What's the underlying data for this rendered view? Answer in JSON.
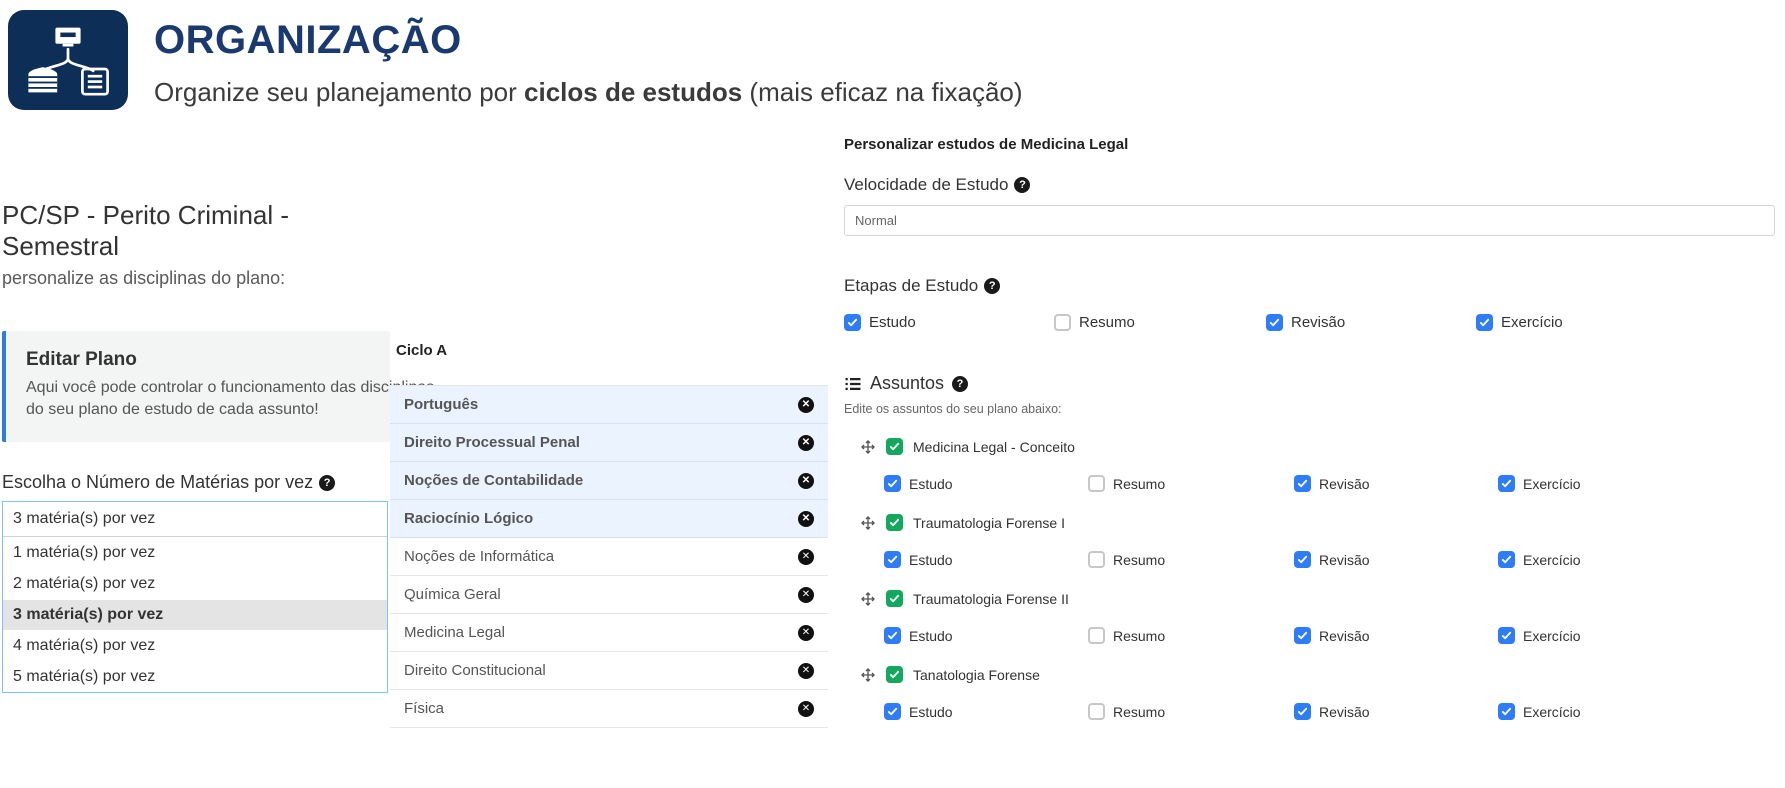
{
  "header": {
    "title": "ORGANIZAÇÃO",
    "subtitle_pre": "Organize seu planejamento por ",
    "subtitle_bold": "ciclos de estudos",
    "subtitle_post": " (mais eficaz na fixação)"
  },
  "left": {
    "plan_title": "PC/SP - Perito Criminal - Semestral",
    "plan_sub": "personalize as disciplinas do plano:",
    "edit_title": "Editar Plano",
    "edit_desc": "Aqui você pode controlar o funcionamento das disciplinas do seu plano de estudo de cada assunto!",
    "mat_label": "Escolha o Número de Matérias por vez",
    "select_current": "3 matéria(s) por vez",
    "select_options": [
      "1 matéria(s) por vez",
      "2 matéria(s) por vez",
      "3 matéria(s) por vez",
      "4 matéria(s) por vez",
      "5 matéria(s) por vez"
    ],
    "select_selected_index": 2
  },
  "cycle": {
    "title": "Ciclo A",
    "items": [
      {
        "label": "Português",
        "hi": true
      },
      {
        "label": "Direito Processual Penal",
        "hi": true
      },
      {
        "label": "Noções de Contabilidade",
        "hi": true
      },
      {
        "label": "Raciocínio Lógico",
        "hi": true
      },
      {
        "label": "Noções de Informática",
        "hi": false
      },
      {
        "label": "Química Geral",
        "hi": false
      },
      {
        "label": "Medicina Legal",
        "hi": false
      },
      {
        "label": "Direito Constitucional",
        "hi": false
      },
      {
        "label": "Física",
        "hi": false
      }
    ]
  },
  "right": {
    "section_title": "Personalizar estudos de Medicina Legal",
    "speed_label": "Velocidade de Estudo",
    "speed_value": "Normal",
    "stages_label": "Etapas de Estudo",
    "stage_names": [
      "Estudo",
      "Resumo",
      "Revisão",
      "Exercício"
    ],
    "stages_on": [
      true,
      false,
      true,
      true
    ],
    "assuntos_label": "Assuntos",
    "assuntos_sub": "Edite os assuntos do seu plano abaixo:",
    "topics": [
      {
        "name": "Medicina Legal - Conceito",
        "stages_on": [
          true,
          false,
          true,
          true
        ]
      },
      {
        "name": "Traumatologia Forense I",
        "stages_on": [
          true,
          false,
          true,
          true
        ]
      },
      {
        "name": "Traumatologia Forense II",
        "stages_on": [
          true,
          false,
          true,
          true
        ]
      },
      {
        "name": "Tanatologia Forense",
        "stages_on": [
          true,
          false,
          true,
          true
        ]
      }
    ]
  }
}
